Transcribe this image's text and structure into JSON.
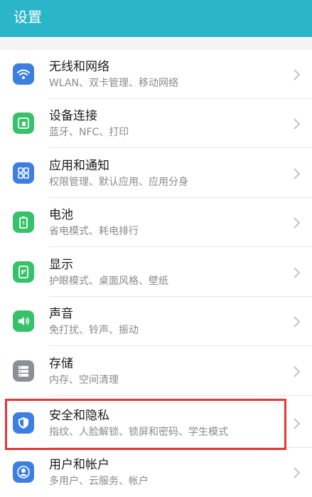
{
  "header": {
    "title": "设置"
  },
  "items": [
    {
      "title": "无线和网络",
      "subtitle": "WLAN、双卡管理、移动网络",
      "icon": "wifi-icon",
      "color": "#3d7fe0"
    },
    {
      "title": "设备连接",
      "subtitle": "蓝牙、NFC、打印",
      "icon": "device-connect-icon",
      "color": "#35c26a"
    },
    {
      "title": "应用和通知",
      "subtitle": "权限管理、默认应用、应用分身",
      "icon": "apps-grid-icon",
      "color": "#3d7fe0"
    },
    {
      "title": "电池",
      "subtitle": "省电模式、耗电排行",
      "icon": "battery-icon",
      "color": "#35c26a"
    },
    {
      "title": "显示",
      "subtitle": "护眼模式、桌面风格、壁纸",
      "icon": "display-icon",
      "color": "#35c26a"
    },
    {
      "title": "声音",
      "subtitle": "免打扰、铃声、振动",
      "icon": "speaker-icon",
      "color": "#35c26a"
    },
    {
      "title": "存储",
      "subtitle": "内存、空间清理",
      "icon": "storage-icon",
      "color": "#8b8f97"
    },
    {
      "title": "安全和隐私",
      "subtitle": "指纹、人脸解锁、锁屏和密码、学生模式",
      "icon": "shield-icon",
      "color": "#3d7fe0"
    },
    {
      "title": "用户和帐户",
      "subtitle": "多用户、云服务、帐户",
      "icon": "user-icon",
      "color": "#3d7fe0"
    }
  ],
  "highlight_color": "#e53935"
}
